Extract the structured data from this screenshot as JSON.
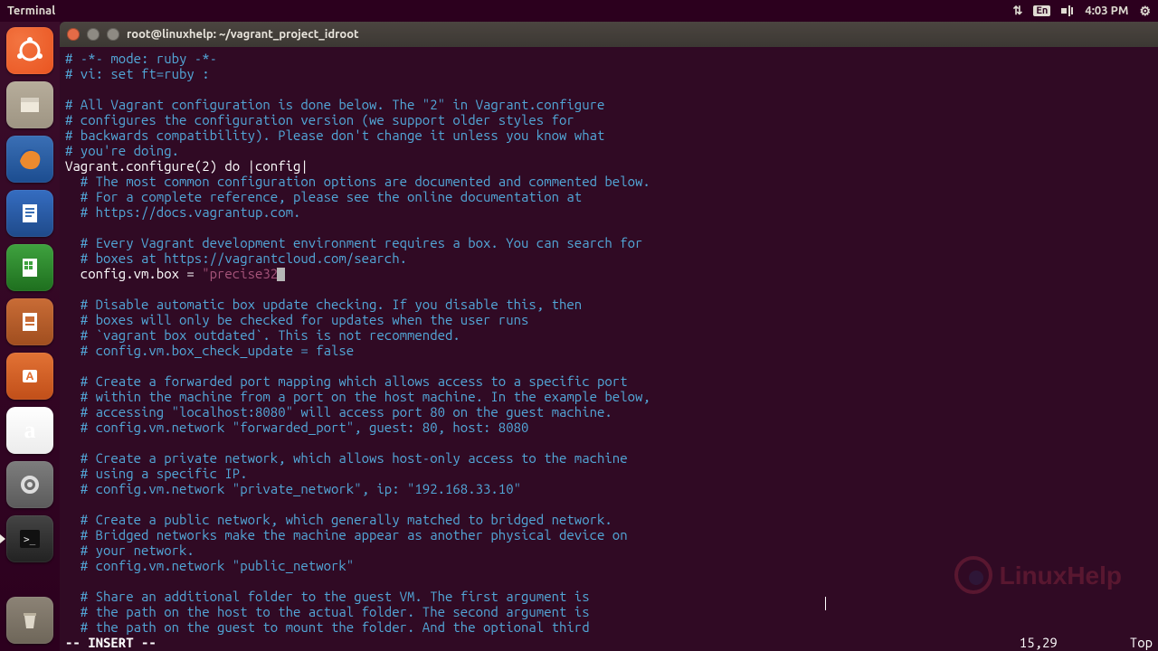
{
  "topbar": {
    "app_title": "Terminal",
    "language_badge": "En",
    "clock": "4:03 PM"
  },
  "window": {
    "title": "root@linuxhelp: ~/vagrant_project_idroot"
  },
  "vim": {
    "mode": "-- INSERT --",
    "cursor_pos": "15,29",
    "scroll_label": "Top",
    "config_box_value": "precise32"
  },
  "file_lines": {
    "l1": "# -*- mode: ruby -*-",
    "l2": "# vi: set ft=ruby :",
    "l3": "",
    "l4": "# All Vagrant configuration is done below. The \"2\" in Vagrant.configure",
    "l5": "# configures the configuration version (we support older styles for",
    "l6": "# backwards compatibility). Please don't change it unless you know what",
    "l7": "# you're doing.",
    "l8": "Vagrant.configure(2) do |config|",
    "l9": "  # The most common configuration options are documented and commented below.",
    "l10": "  # For a complete reference, please see the online documentation at",
    "l11": "  # https://docs.vagrantup.com.",
    "l12": "",
    "l13": "  # Every Vagrant development environment requires a box. You can search for",
    "l14": "  # boxes at https://vagrantcloud.com/search.",
    "l15a": "  config.vm.box = ",
    "l15b": "\"",
    "l15d": "\"",
    "l16": "",
    "l17": "  # Disable automatic box update checking. If you disable this, then",
    "l18": "  # boxes will only be checked for updates when the user runs",
    "l19": "  # `vagrant box outdated`. This is not recommended.",
    "l20": "  # config.vm.box_check_update = false",
    "l21": "",
    "l22": "  # Create a forwarded port mapping which allows access to a specific port",
    "l23": "  # within the machine from a port on the host machine. In the example below,",
    "l24": "  # accessing \"localhost:8080\" will access port 80 on the guest machine.",
    "l25": "  # config.vm.network \"forwarded_port\", guest: 80, host: 8080",
    "l26": "",
    "l27": "  # Create a private network, which allows host-only access to the machine",
    "l28": "  # using a specific IP.",
    "l29": "  # config.vm.network \"private_network\", ip: \"192.168.33.10\"",
    "l30": "",
    "l31": "  # Create a public network, which generally matched to bridged network.",
    "l32": "  # Bridged networks make the machine appear as another physical device on",
    "l33": "  # your network.",
    "l34": "  # config.vm.network \"public_network\"",
    "l35": "",
    "l36": "  # Share an additional folder to the guest VM. The first argument is",
    "l37": "  # the path on the host to the actual folder. The second argument is",
    "l38": "  # the path on the guest to mount the folder. And the optional third"
  },
  "launcher": {
    "items": [
      {
        "name": "ubuntu-dash",
        "glyph": "◌"
      },
      {
        "name": "files",
        "glyph": "🗂"
      },
      {
        "name": "firefox",
        "glyph": "🦊"
      },
      {
        "name": "writer",
        "glyph": "📄"
      },
      {
        "name": "calc",
        "glyph": "📊"
      },
      {
        "name": "impress",
        "glyph": "📈"
      },
      {
        "name": "software",
        "glyph": "A"
      },
      {
        "name": "amazon",
        "glyph": "a"
      },
      {
        "name": "settings",
        "glyph": "⚙"
      },
      {
        "name": "terminal",
        "glyph": ">_"
      },
      {
        "name": "trash",
        "glyph": "🗑"
      }
    ]
  },
  "watermark": {
    "text": "LinuxHelp"
  }
}
